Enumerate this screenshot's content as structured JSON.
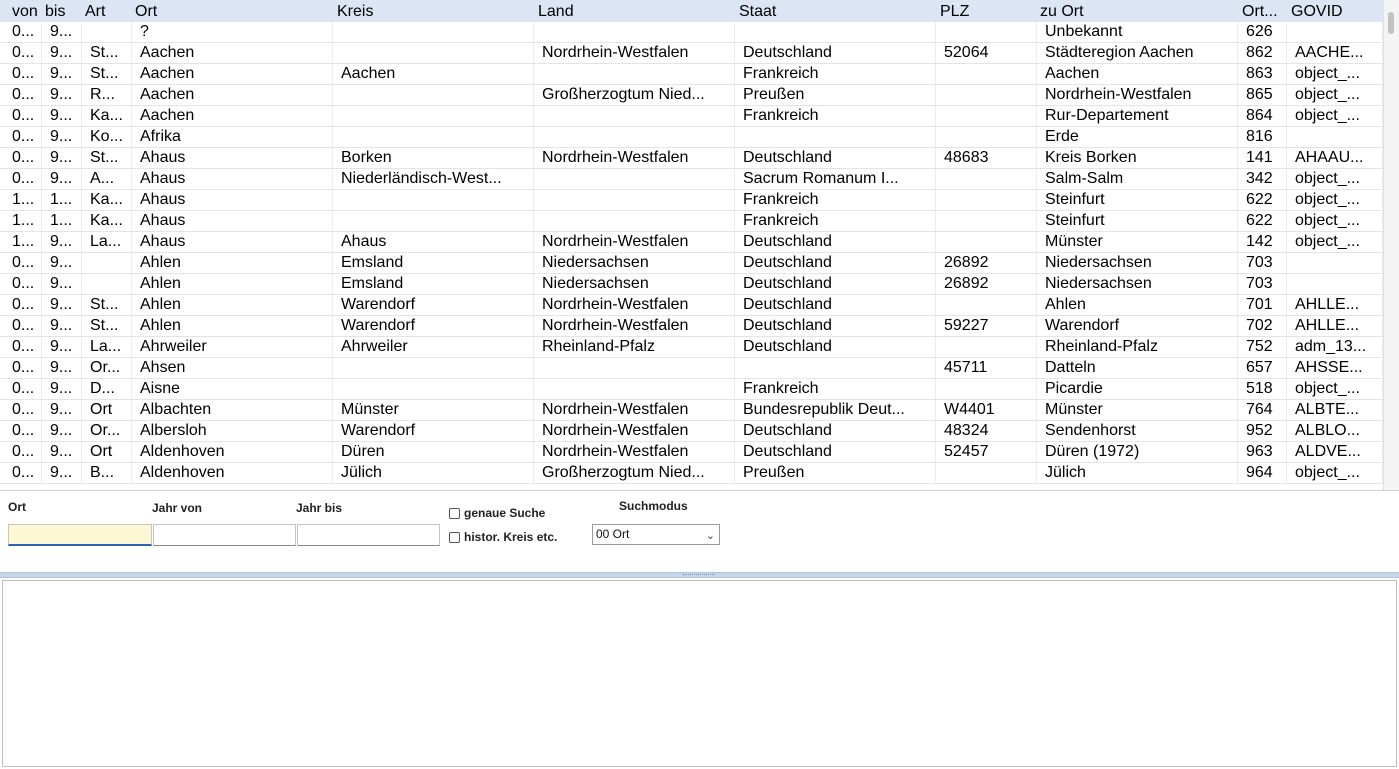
{
  "table": {
    "columns": [
      "von",
      "bis",
      "Art",
      "Ort",
      "Kreis",
      "Land",
      "Staat",
      "PLZ",
      "zu Ort",
      "Ort...",
      "GOVID"
    ],
    "rows": [
      [
        "0...",
        "9...",
        "",
        "?",
        "",
        "",
        "",
        "",
        "Unbekannt",
        "626",
        ""
      ],
      [
        "0...",
        "9...",
        "St...",
        "Aachen",
        "",
        "Nordrhein-Westfalen",
        "Deutschland",
        "52064",
        "Städteregion Aachen",
        "862",
        "AACHE..."
      ],
      [
        "0...",
        "9...",
        "St...",
        "Aachen",
        "Aachen",
        "",
        "Frankreich",
        "",
        "Aachen",
        "863",
        "object_..."
      ],
      [
        "0...",
        "9...",
        "R...",
        "Aachen",
        "",
        "Großherzogtum Nied...",
        "Preußen",
        "",
        "Nordrhein-Westfalen",
        "865",
        "object_..."
      ],
      [
        "0...",
        "9...",
        "Ka...",
        "Aachen",
        "",
        "",
        "Frankreich",
        "",
        "Rur-Departement",
        "864",
        "object_..."
      ],
      [
        "0...",
        "9...",
        "Ko...",
        "Afrika",
        "",
        "",
        "",
        "",
        "Erde",
        "816",
        ""
      ],
      [
        "0...",
        "9...",
        "St...",
        "Ahaus",
        "Borken",
        "Nordrhein-Westfalen",
        "Deutschland",
        "48683",
        "Kreis Borken",
        "141",
        "AHAAU..."
      ],
      [
        "0...",
        "9...",
        "A...",
        "Ahaus",
        "Niederländisch-West...",
        "",
        "Sacrum Romanum I...",
        "",
        "Salm-Salm",
        "342",
        "object_..."
      ],
      [
        "1...",
        "1...",
        "Ka...",
        "Ahaus",
        "",
        "",
        "Frankreich",
        "",
        "Steinfurt",
        "622",
        "object_..."
      ],
      [
        "1...",
        "1...",
        "Ka...",
        "Ahaus",
        "",
        "",
        "Frankreich",
        "",
        "Steinfurt",
        "622",
        "object_..."
      ],
      [
        "1...",
        "9...",
        "La...",
        "Ahaus",
        "Ahaus",
        "Nordrhein-Westfalen",
        "Deutschland",
        "",
        "Münster",
        "142",
        "object_..."
      ],
      [
        "0...",
        "9...",
        "",
        "Ahlen",
        "Emsland",
        "Niedersachsen",
        "Deutschland",
        "26892",
        "Niedersachsen",
        "703",
        ""
      ],
      [
        "0...",
        "9...",
        "",
        "Ahlen",
        "Emsland",
        "Niedersachsen",
        "Deutschland",
        "26892",
        "Niedersachsen",
        "703",
        ""
      ],
      [
        "0...",
        "9...",
        "St...",
        "Ahlen",
        "Warendorf",
        "Nordrhein-Westfalen",
        "Deutschland",
        "",
        "Ahlen",
        "701",
        "AHLLE..."
      ],
      [
        "0...",
        "9...",
        "St...",
        "Ahlen",
        "Warendorf",
        "Nordrhein-Westfalen",
        "Deutschland",
        "59227",
        "Warendorf",
        "702",
        "AHLLE..."
      ],
      [
        "0...",
        "9...",
        "La...",
        "Ahrweiler",
        "Ahrweiler",
        "Rheinland-Pfalz",
        "Deutschland",
        "",
        "Rheinland-Pfalz",
        "752",
        "adm_13..."
      ],
      [
        "0...",
        "9...",
        "Or...",
        "Ahsen",
        "",
        "",
        "",
        "45711",
        "Datteln",
        "657",
        "AHSSE..."
      ],
      [
        "0...",
        "9...",
        "D...",
        "Aisne",
        "",
        "",
        "Frankreich",
        "",
        "Picardie",
        "518",
        "object_..."
      ],
      [
        "0...",
        "9...",
        "Ort",
        "Albachten",
        "Münster",
        "Nordrhein-Westfalen",
        "Bundesrepublik Deut...",
        "W4401",
        "Münster",
        "764",
        "ALBTE..."
      ],
      [
        "0...",
        "9...",
        "Or...",
        "Albersloh",
        "Warendorf",
        "Nordrhein-Westfalen",
        "Deutschland",
        "48324",
        "Sendenhorst",
        "952",
        "ALBLO..."
      ],
      [
        "0...",
        "9...",
        "Ort",
        "Aldenhoven",
        "Düren",
        "Nordrhein-Westfalen",
        "Deutschland",
        "52457",
        "Düren (1972)",
        "963",
        "ALDVE..."
      ],
      [
        "0...",
        "9...",
        "B...",
        "Aldenhoven",
        "Jülich",
        "Großherzogtum Nied...",
        "Preußen",
        "",
        "Jülich",
        "964",
        "object_..."
      ]
    ]
  },
  "search": {
    "ort_label": "Ort",
    "ort_value": "",
    "jahr_von_label": "Jahr von",
    "jahr_von_value": "",
    "jahr_bis_label": "Jahr bis",
    "jahr_bis_value": "",
    "genaue_suche_label": "genaue Suche",
    "histor_label": "histor. Kreis etc.",
    "suchmodus_label": "Suchmodus",
    "suchmodus_value": "00 Ort"
  },
  "output": {
    "text": ""
  }
}
